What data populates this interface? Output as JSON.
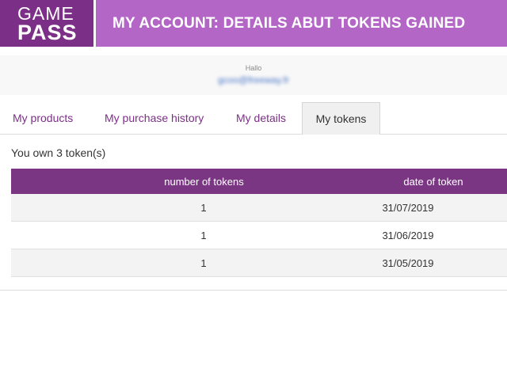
{
  "header": {
    "logo_line1": "GAME",
    "logo_line2": "PASS",
    "title": "MY ACCOUNT: DETAILS ABUT TOKENS GAINED",
    "colors": {
      "logo_bg": "#7c2f87",
      "title_bg": "#b366c6"
    }
  },
  "greeting": {
    "hello": "Hallo",
    "email": "gcoo@freeway.fr"
  },
  "tabs": [
    {
      "label": "My products",
      "active": false
    },
    {
      "label": "My purchase history",
      "active": false
    },
    {
      "label": "My details",
      "active": false
    },
    {
      "label": "My tokens",
      "active": true
    }
  ],
  "tokens": {
    "summary": "You own 3 token(s)",
    "columns": [
      "number of tokens",
      "date of token"
    ],
    "rows": [
      {
        "number": "1",
        "date": "31/07/2019"
      },
      {
        "number": "1",
        "date": "31/06/2019"
      },
      {
        "number": "1",
        "date": "31/05/2019"
      }
    ]
  }
}
